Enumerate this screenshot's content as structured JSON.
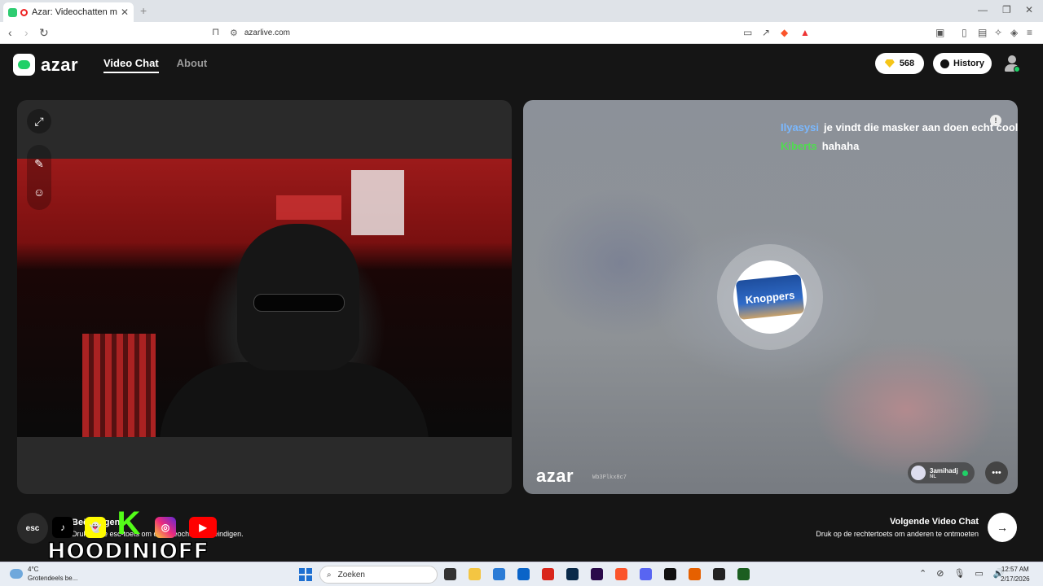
{
  "browser": {
    "tab_title": "Azar: Videochatten met nieuw",
    "url": "azarlive.com"
  },
  "header": {
    "logo_text": "azar",
    "nav": [
      {
        "label": "Video Chat",
        "active": true
      },
      {
        "label": "About",
        "active": false
      }
    ],
    "gems_count": "568",
    "history_label": "History"
  },
  "remote": {
    "chat": [
      {
        "user": "Ilyasysi",
        "message": "je vindt die masker aan doen echt cool",
        "user_color": "#7ab8ff"
      },
      {
        "user": "Kiberts",
        "message": "hahaha",
        "user_color": "#4fdc4f"
      }
    ],
    "avatar_text": "Knoppers",
    "watermark": "azar",
    "room_id": "Wb3Plkx8c7",
    "partner_name": "3amihadj",
    "partner_country": "NL"
  },
  "footer": {
    "esc_label": "esc",
    "esc_title": "Beëindigen",
    "esc_desc": "Druk op de esc-toets om de videochat te beëindigen.",
    "next_title": "Volgende Video Chat",
    "next_desc": "Druk op de rechtertoets om anderen te ontmoeten"
  },
  "overlay": {
    "streamer_name": "HOODINIOFF",
    "socials": [
      "tiktok-icon",
      "snapchat-icon",
      "kick-icon",
      "instagram-icon",
      "youtube-icon"
    ]
  },
  "taskbar": {
    "weather_temp": "4°C",
    "weather_desc": "Grotendeels be...",
    "search_placeholder": "Zoeken",
    "time": "12:57 AM",
    "date": "2/17/2026"
  },
  "colors": {
    "accent_green": "#1fd067",
    "background": "#151515"
  }
}
